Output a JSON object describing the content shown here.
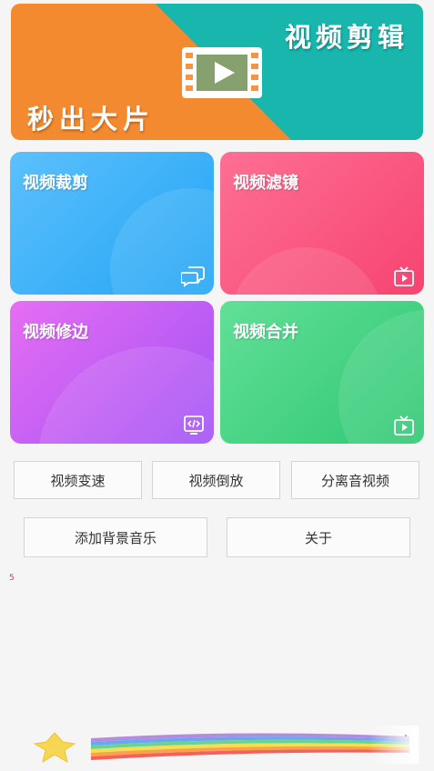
{
  "banner": {
    "title": "视频剪辑",
    "slogan": "秒出大片"
  },
  "cards": [
    {
      "label": "视频裁剪",
      "icon": "chat-bubbles-icon"
    },
    {
      "label": "视频滤镜",
      "icon": "tv-play-icon"
    },
    {
      "label": "视频修边",
      "icon": "code-monitor-icon"
    },
    {
      "label": "视频合并",
      "icon": "tv-play-icon"
    }
  ],
  "buttons": {
    "speed": "视频变速",
    "reverse": "视频倒放",
    "separate_audio": "分离音视频",
    "add_music": "添加背景音乐",
    "about": "关于"
  },
  "footer": {
    "small_number": "5",
    "decoration": "rainbow-star-icon"
  },
  "colors": {
    "banner_orange": "#f48a2f",
    "banner_teal": "#18b6ad",
    "card_blue": "#23a5f5",
    "card_pink": "#f64470",
    "card_purple": "#a252f5",
    "card_green": "#30c874"
  }
}
